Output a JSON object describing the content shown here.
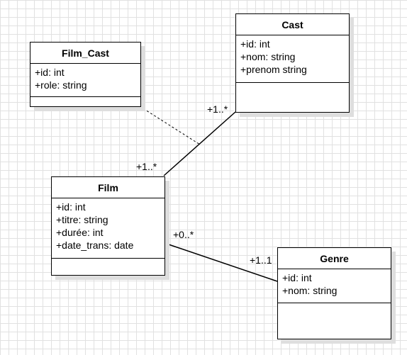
{
  "classes": {
    "film_cast": {
      "name": "Film_Cast",
      "attributes": [
        "+id: int",
        "+role: string"
      ]
    },
    "cast": {
      "name": "Cast",
      "attributes": [
        "+id: int",
        "+nom: string",
        "+prenom string"
      ]
    },
    "film": {
      "name": "Film",
      "attributes": [
        "+id: int",
        "+titre: string",
        "+durée: int",
        "+date_trans: date"
      ]
    },
    "genre": {
      "name": "Genre",
      "attributes": [
        "+id: int",
        "+nom: string"
      ]
    }
  },
  "associations": {
    "film_cast": {
      "film_end": "+1..*",
      "cast_end": "+1..*"
    },
    "film_genre": {
      "film_end": "+0..*",
      "genre_end": "+1..1"
    }
  },
  "colors": {
    "line": "#000000",
    "grid": "#e1e1e1",
    "shadow": "#dedede"
  }
}
